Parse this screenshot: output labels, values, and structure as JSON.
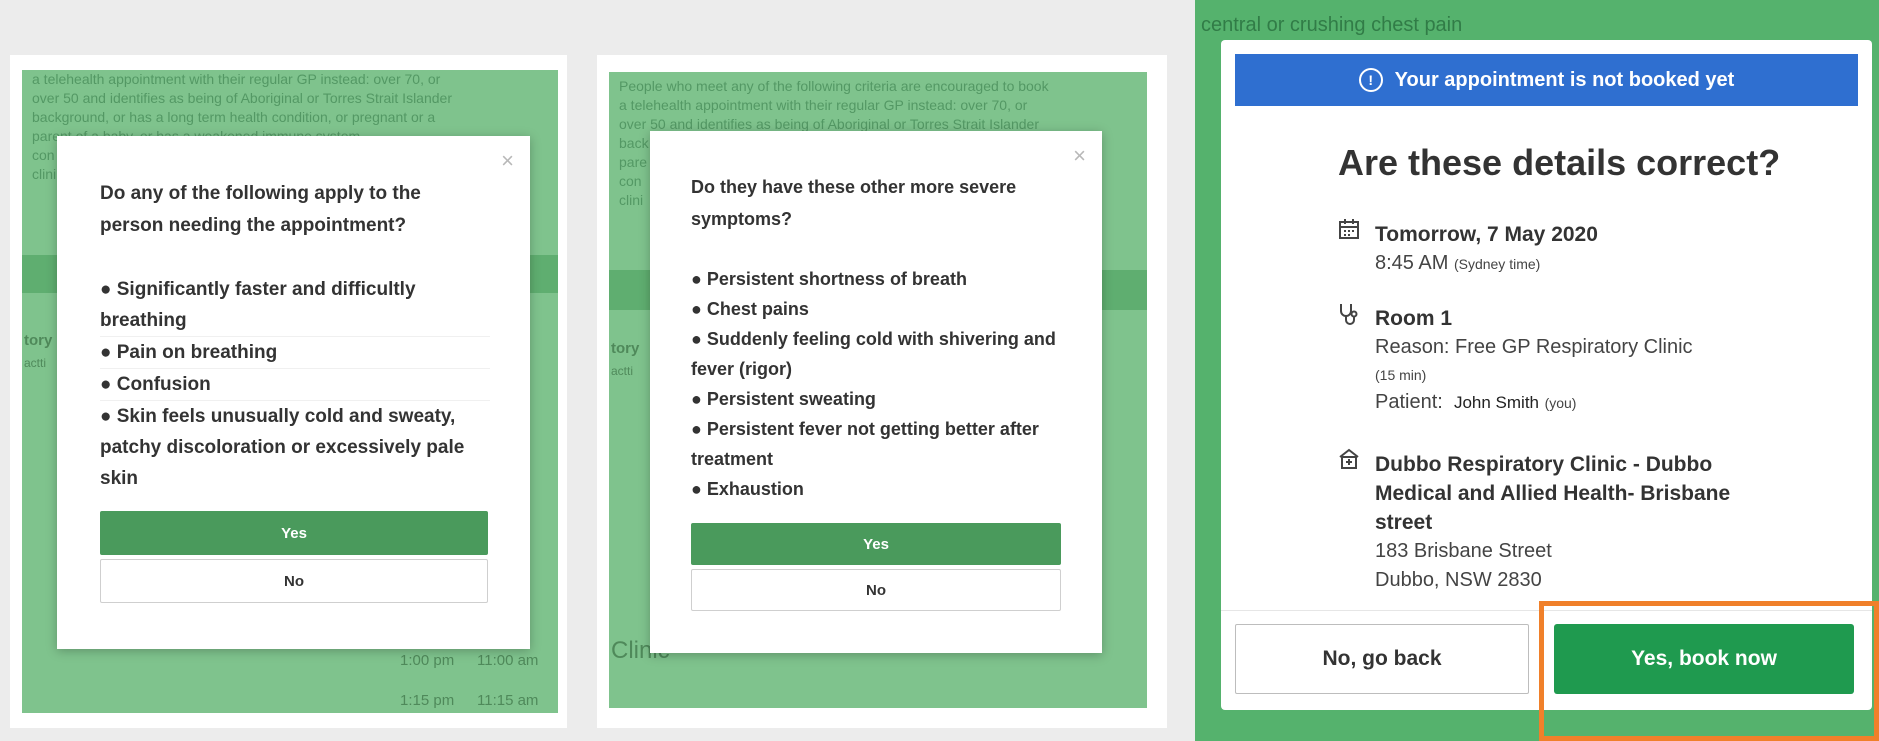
{
  "panel1": {
    "bg_text": [
      "a telehealth appointment with their regular GP instead: over 70, or",
      "over 50 and identifies as being of Aboriginal or Torres Strait Islander",
      "background, or has a long term health condition, or pregnant or a",
      "parent of a baby, or has a weakened immune system.",
      "con",
      "clini"
    ],
    "bg_side": [
      "tory",
      "actti"
    ],
    "bg_times": [
      [
        "1:00 pm",
        "11:00 am"
      ],
      [
        "1:15 pm",
        "11:15 am"
      ]
    ],
    "close": "×",
    "question": "Do any of the following apply to the person needing the appointment?",
    "symptoms": [
      "● Significantly faster and difficultly breathing",
      "● Pain on breathing",
      "● Confusion",
      "● Skin feels unusually cold and sweaty, patchy discoloration or excessively pale skin"
    ],
    "yes": "Yes",
    "no": "No"
  },
  "panel2": {
    "bg_text": [
      "People who meet any of the following criteria are encouraged to book",
      "a telehealth appointment with their regular GP instead: over 70, or",
      "over 50 and identifies as being of Aboriginal or Torres Strait Islander",
      "back",
      "pare",
      "con",
      "clini"
    ],
    "bg_side": [
      "tory",
      "actti"
    ],
    "bg_clinic": "Clinic",
    "close": "×",
    "question": "Do they have these other more severe symptoms?",
    "symptoms": [
      "● Persistent shortness of breath",
      "● Chest pains",
      "● Suddenly feeling cold with shivering and fever (rigor)",
      "● Persistent sweating",
      "● Persistent fever not getting better after treatment",
      "● Exhaustion"
    ],
    "yes": "Yes",
    "no": "No"
  },
  "panel3": {
    "bg_text": [
      "central or crushing chest pain"
    ],
    "banner": "Your appointment is not booked yet",
    "banner_icon": "info-icon",
    "title": "Are these details correct?",
    "date": {
      "icon": "calendar-icon",
      "head": "Tomorrow, 7 May 2020",
      "time": "8:45 AM",
      "tz": "(Sydney time)"
    },
    "room": {
      "icon": "stethoscope-icon",
      "head": "Room 1",
      "reason": "Reason: Free GP Respiratory Clinic",
      "duration": "(15 min)",
      "patient_label": "Patient:",
      "patient_name": "John Smith",
      "patient_you": "(you)"
    },
    "clinic": {
      "icon": "clinic-icon",
      "head": "Dubbo Respiratory Clinic - Dubbo Medical and Allied Health- Brisbane street",
      "address1": "183 Brisbane Street",
      "address2": "Dubbo, NSW 2830"
    },
    "back": "No, go back",
    "book": "Yes, book now"
  },
  "colors": {
    "green_bg": "#7fc38d",
    "button_green": "#4a9a5c",
    "book_green": "#1f9a4f",
    "banner_blue": "#2f6fd0",
    "highlight_orange": "#f0802a"
  }
}
